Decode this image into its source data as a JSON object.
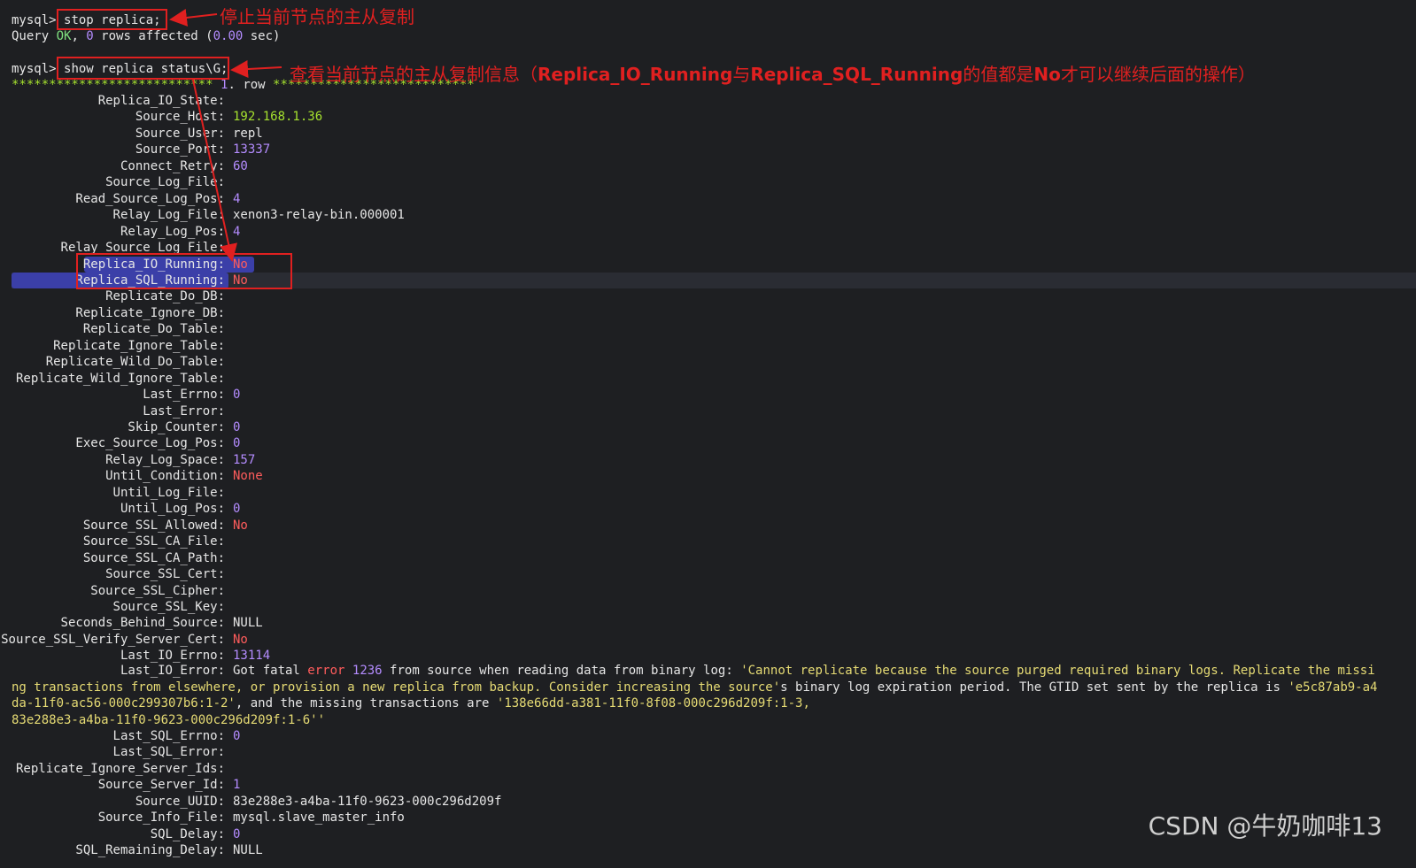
{
  "terminal": {
    "prompt": "mysql>",
    "cmd1": "stop replica;",
    "query_ok": {
      "pre": "Query ",
      "ok": "OK",
      "mid": ", ",
      "zero": "0",
      "post": " rows affected (",
      "secs": "0.00",
      "end": " sec)"
    },
    "cmd2": "show replica status\\G;",
    "row_header": {
      "stars1": "*************************** ",
      "num": "1",
      "dot": ".",
      "row": " row ",
      "stars2": "***************************"
    },
    "fields": [
      {
        "key": "Replica_IO_State",
        "value": "",
        "color": "white"
      },
      {
        "key": "Source_Host",
        "value": "192.168.1.36",
        "color": "lime"
      },
      {
        "key": "Source_User",
        "value": "repl",
        "color": "white"
      },
      {
        "key": "Source_Port",
        "value": "13337",
        "color": "purple"
      },
      {
        "key": "Connect_Retry",
        "value": "60",
        "color": "purple"
      },
      {
        "key": "Source_Log_File",
        "value": "",
        "color": "white"
      },
      {
        "key": "Read_Source_Log_Pos",
        "value": "4",
        "color": "purple"
      },
      {
        "key": "Relay_Log_File",
        "value": "xenon3-relay-bin.000001",
        "color": "white"
      },
      {
        "key": "Relay_Log_Pos",
        "value": "4",
        "color": "purple"
      },
      {
        "key": "Relay_Source_Log_File",
        "value": "",
        "color": "white"
      },
      {
        "key": "Replica_IO_Running",
        "value": "No",
        "color": "red"
      },
      {
        "key": "Replica_SQL_Running",
        "value": "No",
        "color": "red"
      },
      {
        "key": "Replicate_Do_DB",
        "value": "",
        "color": "white"
      },
      {
        "key": "Replicate_Ignore_DB",
        "value": "",
        "color": "white"
      },
      {
        "key": "Replicate_Do_Table",
        "value": "",
        "color": "white"
      },
      {
        "key": "Replicate_Ignore_Table",
        "value": "",
        "color": "white"
      },
      {
        "key": "Replicate_Wild_Do_Table",
        "value": "",
        "color": "white"
      },
      {
        "key": "Replicate_Wild_Ignore_Table",
        "value": "",
        "color": "white"
      },
      {
        "key": "Last_Errno",
        "value": "0",
        "color": "purple"
      },
      {
        "key": "Last_Error",
        "value": "",
        "color": "white"
      },
      {
        "key": "Skip_Counter",
        "value": "0",
        "color": "purple"
      },
      {
        "key": "Exec_Source_Log_Pos",
        "value": "0",
        "color": "purple"
      },
      {
        "key": "Relay_Log_Space",
        "value": "157",
        "color": "purple"
      },
      {
        "key": "Until_Condition",
        "value": "None",
        "color": "red"
      },
      {
        "key": "Until_Log_File",
        "value": "",
        "color": "white"
      },
      {
        "key": "Until_Log_Pos",
        "value": "0",
        "color": "purple"
      },
      {
        "key": "Source_SSL_Allowed",
        "value": "No",
        "color": "red"
      },
      {
        "key": "Source_SSL_CA_File",
        "value": "",
        "color": "white"
      },
      {
        "key": "Source_SSL_CA_Path",
        "value": "",
        "color": "white"
      },
      {
        "key": "Source_SSL_Cert",
        "value": "",
        "color": "white"
      },
      {
        "key": "Source_SSL_Cipher",
        "value": "",
        "color": "white"
      },
      {
        "key": "Source_SSL_Key",
        "value": "",
        "color": "white"
      },
      {
        "key": "Seconds_Behind_Source",
        "value": "NULL",
        "color": "white"
      },
      {
        "key": "Source_SSL_Verify_Server_Cert",
        "value": "No",
        "color": "red"
      },
      {
        "key": "Last_IO_Errno",
        "value": "13114",
        "color": "purple"
      }
    ],
    "io_error": {
      "key": "Last_IO_Error",
      "p1": "Got fatal ",
      "p2": "error",
      "p3": " ",
      "p4": "1236",
      "p5": " from source when reading data from binary log: ",
      "p6": "'Cannot replicate because the source purged required binary logs. Replicate the missing transactions from elsewhere, or provision a new replica from backup. Consider increasing the source'",
      "p7": "s binary log expiration period. The GTID set sent by the replica is ",
      "p8": "'e5c87ab9-a4da-11f0-ac56-000c299307b6:1-2'",
      "p9": ", and the missing transactions are ",
      "p10": "'138e66dd-a381-11f0-8f08-000c296d209f:1-3,",
      "p11": "83e288e3-a4ba-11f0-9623-000c296d209f:1-6''"
    },
    "fields2": [
      {
        "key": "Last_SQL_Errno",
        "value": "0",
        "color": "purple"
      },
      {
        "key": "Last_SQL_Error",
        "value": "",
        "color": "white"
      },
      {
        "key": "Replicate_Ignore_Server_Ids",
        "value": "",
        "color": "white"
      },
      {
        "key": "Source_Server_Id",
        "value": "1",
        "color": "purple"
      },
      {
        "key": "Source_UUID",
        "value": "83e288e3-a4ba-11f0-9623-000c296d209f",
        "color": "white"
      },
      {
        "key": "Source_Info_File",
        "value": "mysql.slave_master_info",
        "color": "white"
      },
      {
        "key": "SQL_Delay",
        "value": "0",
        "color": "purple"
      },
      {
        "key": "SQL_Remaining_Delay",
        "value": "NULL",
        "color": "white"
      }
    ]
  },
  "annotations": {
    "a1": "停止当前节点的主从复制",
    "a2_pre": "查看当前节点的主从复制信息（",
    "a2_bold1": "Replica_IO_Running",
    "a2_mid": "与",
    "a2_bold2": "Replica_SQL_Running",
    "a2_mid2": "的值都是",
    "a2_bold3": "No",
    "a2_post": "才可以继续后面的操作）"
  },
  "watermark": "CSDN @牛奶咖啡13"
}
